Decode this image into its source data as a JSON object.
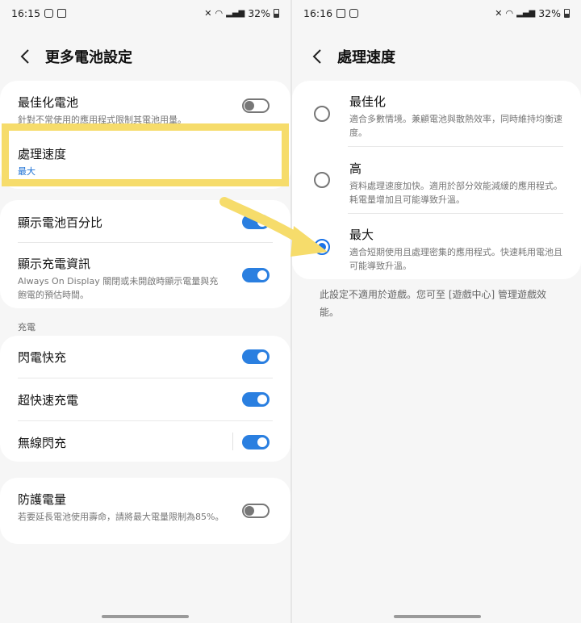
{
  "left": {
    "status": {
      "time": "16:15",
      "battery": "32%"
    },
    "header": {
      "title": "更多電池設定"
    },
    "card1": {
      "optimize": {
        "title": "最佳化電池",
        "sub": "針對不常使用的應用程式限制其電池用量。",
        "toggle": false
      },
      "speed": {
        "title": "處理速度",
        "value": "最大"
      }
    },
    "card2": {
      "percent": {
        "title": "顯示電池百分比",
        "toggle": true
      },
      "charge_info": {
        "title": "顯示充電資訊",
        "sub": "Always On Display 關閉或未開啟時顯示電量與充飽電的預估時間。",
        "toggle": true
      }
    },
    "charging_label": "充電",
    "card3": {
      "fast": {
        "title": "閃電快充",
        "toggle": true
      },
      "superfast": {
        "title": "超快速充電",
        "toggle": true
      },
      "wireless": {
        "title": "無線閃充",
        "toggle": true
      }
    },
    "card4": {
      "protect": {
        "title": "防護電量",
        "sub": "若要延長電池使用壽命，請將最大電量限制為85%。",
        "toggle": false
      }
    }
  },
  "right": {
    "status": {
      "time": "16:16",
      "battery": "32%"
    },
    "header": {
      "title": "處理速度"
    },
    "options": [
      {
        "title": "最佳化",
        "sub": "適合多數情境。兼顧電池與散熱效率，同時維持均衡速度。",
        "selected": false
      },
      {
        "title": "高",
        "sub": "資料處理速度加快。適用於部分效能減緩的應用程式。耗電量增加且可能導致升溫。",
        "selected": false
      },
      {
        "title": "最大",
        "sub": "適合短期使用且處理密集的應用程式。快速耗用電池且可能導致升溫。",
        "selected": true
      }
    ],
    "note": "此設定不適用於遊戲。您可至 [遊戲中心] 管理遊戲效能。"
  },
  "colors": {
    "accent": "#2a7fe0",
    "highlight": "#f6dc6b"
  }
}
